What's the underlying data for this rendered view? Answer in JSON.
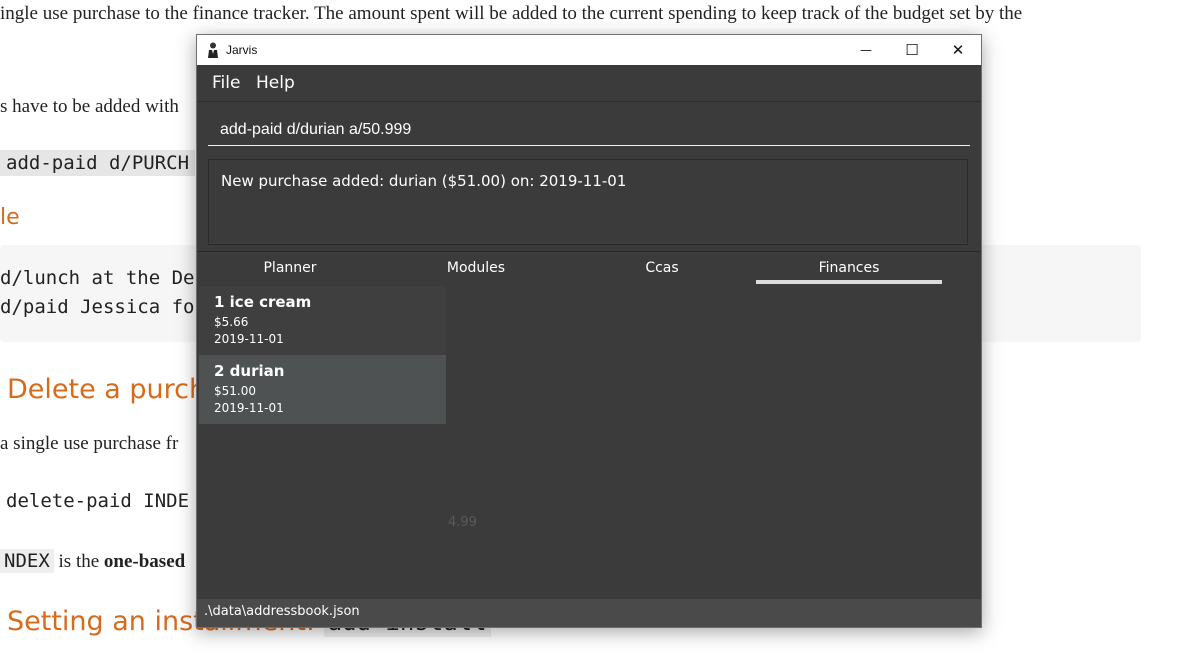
{
  "doc": {
    "line1": "ingle use purchase to the finance tracker. The amount spent will be added to the current spending to keep track of the budget set by the",
    "line2": "s have to be added with",
    "code1": "add-paid d/PURCH",
    "heading_example": "le",
    "code_block_line1": "d/lunch at the De",
    "code_block_line2": "d/paid Jessica fo",
    "heading_delete": "Delete a purch",
    "line3": "a single use purchase fr",
    "code2": "delete-paid INDE",
    "index_code": "NDEX",
    "line4_a": " is the ",
    "line4_b": "one-based",
    "heading_install": "Setting an installment:",
    "install_code": "add-install"
  },
  "window": {
    "title": "Jarvis",
    "controls": {
      "minimize": "—",
      "maximize": "☐",
      "close": "✕"
    },
    "menu": [
      {
        "label": "File"
      },
      {
        "label": "Help"
      }
    ],
    "command": {
      "value": "add-paid d/durian a/50.999"
    },
    "result": "New purchase added: durian ($51.00) on: 2019-11-01",
    "tabs": [
      {
        "label": "Planner"
      },
      {
        "label": "Modules"
      },
      {
        "label": "Ccas"
      },
      {
        "label": "Finances",
        "active": true
      }
    ],
    "purchases": [
      {
        "title": "1 ice cream",
        "amount": "$5.66",
        "date": "2019-11-01"
      },
      {
        "title": "2 durian",
        "amount": "$51.00",
        "date": "2019-11-01"
      }
    ],
    "faint_value": "4.99",
    "status_path": ".\\data\\addressbook.json"
  },
  "colors": {
    "accent_heading": "#d86a1c",
    "window_bg": "#3b3b3b",
    "card_bg": "#3f3f3f",
    "card_selected_bg": "#4f5253",
    "statusbar_bg": "#4a4a4a"
  }
}
